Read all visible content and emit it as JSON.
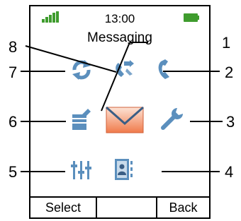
{
  "status": {
    "time": "13:00",
    "signal_icon": "signal-strength-icon",
    "battery_icon": "battery-full-icon",
    "accent": "#3f9c2e"
  },
  "menu": {
    "title": "Messaging"
  },
  "softkeys": {
    "left": "Select",
    "middle": "",
    "right": "Back"
  },
  "icons": [
    {
      "number": "1",
      "name": "messaging-envelope-icon",
      "selected": true
    },
    {
      "number": "2",
      "name": "phone-handset-icon"
    },
    {
      "number": "3",
      "name": "wrench-settings-icon"
    },
    {
      "number": "4",
      "name": "contacts-book-icon"
    },
    {
      "number": "5",
      "name": "equalizer-sliders-icon"
    },
    {
      "number": "6",
      "name": "notepad-icon"
    },
    {
      "number": "7",
      "name": "sync-arrows-icon"
    },
    {
      "number": "8",
      "name": "call-forward-icon"
    }
  ],
  "callouts": [
    "1",
    "2",
    "3",
    "4",
    "5",
    "6",
    "7",
    "8"
  ],
  "colors": {
    "icon_blue": "#5b8fbd",
    "selected_orange": "#f07a4a",
    "signal_green": "#3f9c2e"
  }
}
